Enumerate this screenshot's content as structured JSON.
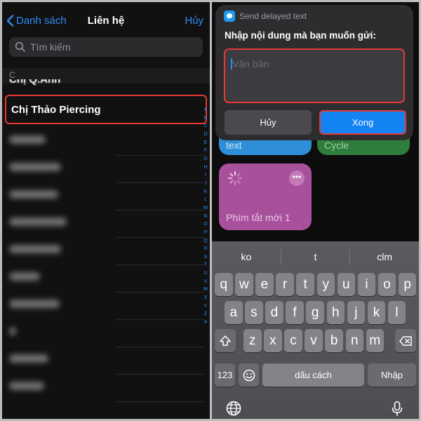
{
  "left": {
    "nav": {
      "back_label": "Danh sách",
      "title": "Liên hệ",
      "cancel_label": "Hủy"
    },
    "search": {
      "placeholder": "Tìm kiếm"
    },
    "section_letter": "C",
    "peek_contact": "Chị Q.Anh",
    "selected_contact": "Chị Thảo Piercing",
    "index_letters": [
      "A",
      "B",
      "C",
      "D",
      "E",
      "F",
      "G",
      "H",
      "I",
      "J",
      "K",
      "L",
      "M",
      "N",
      "O",
      "P",
      "Q",
      "R",
      "S",
      "T",
      "U",
      "V",
      "W",
      "X",
      "Y",
      "Z",
      "#"
    ]
  },
  "right": {
    "dialog": {
      "app_name": "Send delayed text",
      "prompt": "Nhập nội dung mà bạn muốn gửi:",
      "input_placeholder": "Văn bản",
      "cancel_label": "Hủy",
      "done_label": "Xong"
    },
    "tiles": {
      "blue_label": "text",
      "green_label": "Cycle",
      "purple_label": "Phím tắt mới 1"
    },
    "keyboard": {
      "suggestions": [
        "ko",
        "t",
        "clm"
      ],
      "row1": [
        "q",
        "w",
        "e",
        "r",
        "t",
        "y",
        "u",
        "i",
        "o",
        "p"
      ],
      "row2": [
        "a",
        "s",
        "d",
        "f",
        "g",
        "h",
        "j",
        "k",
        "l"
      ],
      "row3": [
        "z",
        "x",
        "c",
        "v",
        "b",
        "n",
        "m"
      ],
      "numbers_label": "123",
      "space_label": "dấu cách",
      "return_label": "Nhập"
    }
  },
  "colors": {
    "accent_blue": "#2f8bf5",
    "highlight_red": "#e53935",
    "done_blue": "#1382f3"
  }
}
